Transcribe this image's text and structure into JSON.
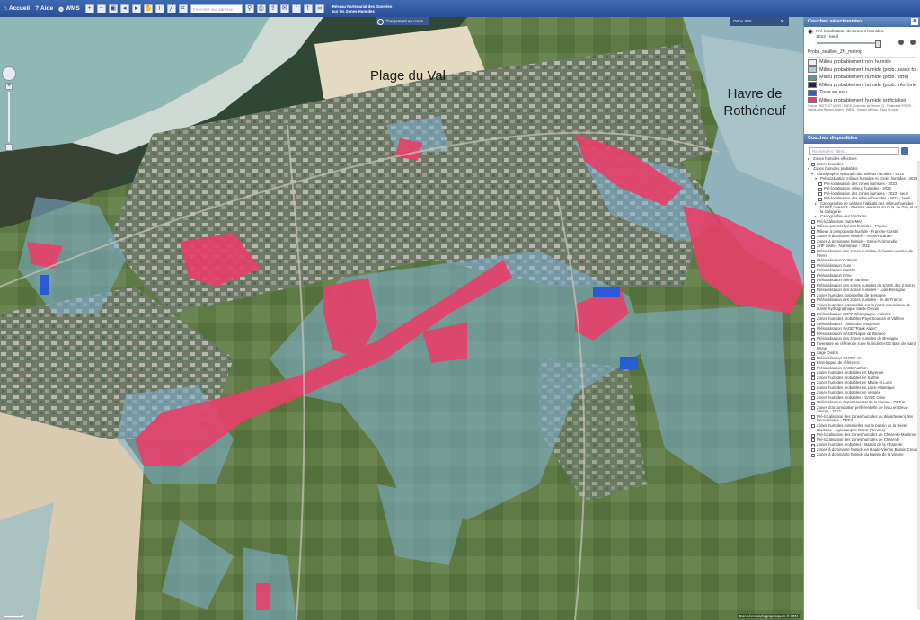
{
  "toolbar": {
    "home_label": "Accueil",
    "help_label": "Aide",
    "wms_label": "WMS",
    "search_placeholder": "Chercher une adresse",
    "app_title": "Réseau Partenarial des Données sur les Zones Humides"
  },
  "status": {
    "loading_label": "Chargement en cours..."
  },
  "map": {
    "basemap_select": "Ortho IGN",
    "places": [
      "Plage du Val",
      "Havre de Rothéneuf"
    ],
    "attribution": "Données cartographiques © IGN"
  },
  "selected_layers": {
    "header": "Couches sélectionnées",
    "layer_name": "Pré-localisation des zones humides - 2023 - seuil",
    "style_name": "Proba_seuillee_ZH_metrop",
    "legend": [
      {
        "label": "Milieu probablement non humide",
        "color": "#e9eff0"
      },
      {
        "label": "Milieu probablement humide (prob. assez forte)",
        "color": "#a9ccd6"
      },
      {
        "label": "Milieu probablement humide (prob. forte)",
        "color": "#5d93ac"
      },
      {
        "label": "Milieu probablement humide (prob. très forte)",
        "color": "#1b2b3d"
      },
      {
        "label": "Zone en eau",
        "color": "#2a5bd7"
      },
      {
        "label": "Milieu probablement humide artificialisé",
        "color": "#e83f69"
      }
    ],
    "source": "Source : INSTITUT AGRO / CNRS (Université de Rennes 2) - Partenariat RPDZH - Institut Agro Rennes-Angers - INRAE - Agence de l'eau - Fond de carte"
  },
  "available_layers": {
    "header": "Couches disponibles",
    "search_placeholder": "Rechercher, filtrer...",
    "tree": [
      {
        "label": "Zones humides effectives",
        "level": 0,
        "twisty": "▸"
      },
      {
        "label": "Zones humides",
        "level": 1
      },
      {
        "label": "Zones humides probables",
        "level": 0,
        "twisty": "▾"
      },
      {
        "label": "Cartographie nationale des milieux humides - 2023",
        "level": 1,
        "twisty": "▾"
      },
      {
        "label": "Prélocalisation milieux humides et zones humides - 2023",
        "level": 2,
        "twisty": "▾"
      },
      {
        "label": "Pré-localisation des zones humides - 2023",
        "level": 3
      },
      {
        "label": "Pré-localisation milieux humides - 2023",
        "level": 3
      },
      {
        "label": "Pré-localisation des zones humides - 2023 - seuil",
        "level": 3
      },
      {
        "label": "Pré-localisation des milieux humides - 2023 - seuil",
        "level": 3
      },
      {
        "label": "Cartographie de certains habitats des milieux humides EUNIS niveau 3 - Bassins versants du Gua, de Guy et de la Calogerie",
        "level": 2,
        "twisty": "▸"
      },
      {
        "label": "Cartographie des fonctions",
        "level": 2,
        "twisty": "▸"
      },
      {
        "label": "Pré-localisation Outre-Mer",
        "level": 1
      },
      {
        "label": "Milieux potentiellement humides - France",
        "level": 1
      },
      {
        "label": "Milieux à composante humide - Franche-Comté",
        "level": 1
      },
      {
        "label": "Zones à dominante humide - Artois-Picardie",
        "level": 1
      },
      {
        "label": "Zones à dominante humide - Seine-Normandie",
        "level": 1
      },
      {
        "label": "ZHP Seine - Normandie - 2022",
        "level": 1
      },
      {
        "label": "Prélocalisation des zones humides du bassin versant de l'Yerre",
        "level": 1
      },
      {
        "label": "Prélocalisation Cotentin",
        "level": 1
      },
      {
        "label": "Prélocalisation Cure",
        "level": 1
      },
      {
        "label": "Prélocalisation Marche",
        "level": 1
      },
      {
        "label": "Prélocalisation Orne",
        "level": 1
      },
      {
        "label": "Prélocalisation Seine maritime",
        "level": 1
      },
      {
        "label": "Prélocalisation des zones humides du SAGE des 2 Morin",
        "level": 1
      },
      {
        "label": "Prélocalisation des zones humides - Loire-Bretagne",
        "level": 1
      },
      {
        "label": "Zones humides potentielles de Bretagne",
        "level": 1
      },
      {
        "label": "Prélocalisation des zones humides - Ile de France",
        "level": 1
      },
      {
        "label": "Zones humides potentielles sur la partie meusienne de l'Unité hydrographique Saulx-Ornain",
        "level": 1
      },
      {
        "label": "Prélocalisation CRPF Champagne-Ardenne",
        "level": 1
      },
      {
        "label": "Zones humides probables Pays Sources et Vallées",
        "level": 1
      },
      {
        "label": "Prélocalisation \"Unité Glan Moyenne\"",
        "level": 1
      },
      {
        "label": "Prélocalisation SAGE \"Rank Aabis\"",
        "level": 1
      },
      {
        "label": "Prélocalisation SAGE Nappe de Beauce",
        "level": 1
      },
      {
        "label": "Prélocalisation des zones humides de Bretagne",
        "level": 1
      },
      {
        "label": "Inventaire de référence zone humide SAGE Baie de Saint-Brieuc",
        "level": 1
      },
      {
        "label": "Sage Oudon",
        "level": 1
      },
      {
        "label": "Prélocalisation SAGE Loir",
        "level": 1
      },
      {
        "label": "Enveloppes de référence",
        "level": 1
      },
      {
        "label": "Prélocalisation SAGE Authion",
        "level": 1
      },
      {
        "label": "Zones humides probables en Mayenne",
        "level": 1
      },
      {
        "label": "Zones humides probables en Sarthe",
        "level": 1
      },
      {
        "label": "Zones humides probables en Maine et Loire",
        "level": 1
      },
      {
        "label": "Zones humides probables en Loire-Atlantique",
        "level": 1
      },
      {
        "label": "Zones humides probables en Vendée",
        "level": 1
      },
      {
        "label": "Zones humides probables - SAGE Clain",
        "level": 1
      },
      {
        "label": "Prélocalisation départemental de la Vienne - DREAL",
        "level": 1
      },
      {
        "label": "Zones d'accumulation préférentielle de l'eau en Deux-Sèvres - 2017",
        "level": 1
      },
      {
        "label": "Pré-localisation des zones humides du département des Deux-Sèvres - DREAL",
        "level": 1
      },
      {
        "label": "Zones humides potentielles sur le bassin de la Sèvre Niortaise - Agrocampus Ouest (Rennes)",
        "level": 1
      },
      {
        "label": "Pré-localisation des zones humides de Charente-Maritime",
        "level": 1
      },
      {
        "label": "Pré-localisation des zones humides de Charente",
        "level": 1
      },
      {
        "label": "Zones humides probables - Bassin de la Charente",
        "level": 1
      },
      {
        "label": "Zones à dominante humide en Haute-Vienne Bassin Creuse",
        "level": 1
      },
      {
        "label": "Zones à dominante humide du bassin de la Vienne",
        "level": 1
      }
    ]
  }
}
